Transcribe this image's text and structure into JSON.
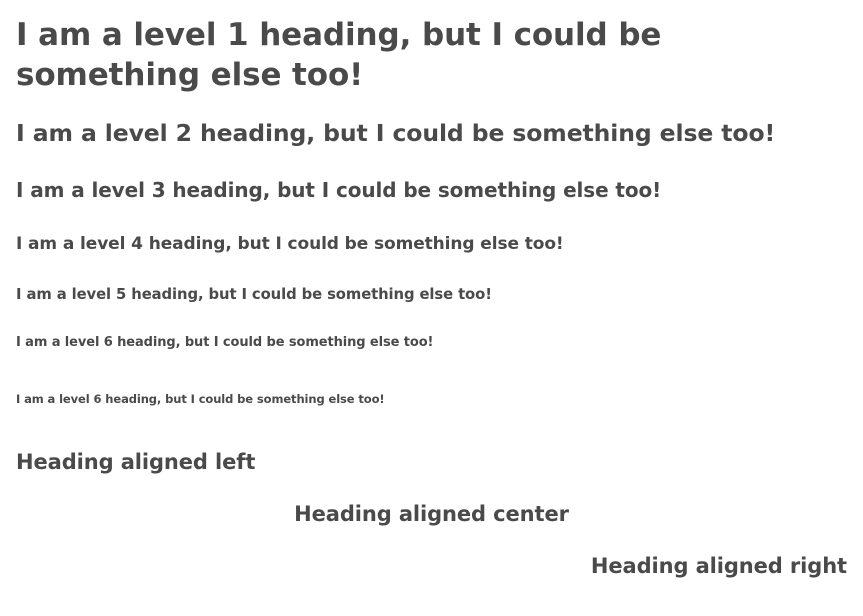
{
  "headings": {
    "h1": "I am a level 1 heading, but I could be something else too!",
    "h2": "I am a level 2 heading, but I could be something else too!",
    "h3": "I am a level 3 heading, but I could be something else too!",
    "h4": "I am a level 4 heading, but I could be something else too!",
    "h5": "I am a level 5 heading, but I could be something else too!",
    "h6": "I am a level 6 heading, but I could be something else too!",
    "h6_small": "I am a level 6 heading, but I could be something else too!"
  },
  "alignment": {
    "left": "Heading aligned left",
    "center": "Heading aligned center",
    "right": "Heading aligned right"
  },
  "colors": {
    "text": "#4a4a4a",
    "background": "#ffffff"
  }
}
